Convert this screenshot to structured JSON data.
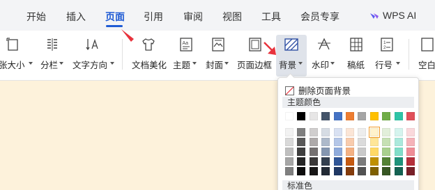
{
  "menu": {
    "tabs": [
      {
        "label": "开始"
      },
      {
        "label": "插入"
      },
      {
        "label": "页面"
      },
      {
        "label": "引用"
      },
      {
        "label": "审阅"
      },
      {
        "label": "视图"
      },
      {
        "label": "工具"
      },
      {
        "label": "会员专享"
      }
    ],
    "active_tab": "页面",
    "ai_label": "WPS AI"
  },
  "ribbon": {
    "size": "张大小",
    "columns": "分栏",
    "text_direction": "文字方向",
    "beautify": "文档美化",
    "theme": "主题",
    "cover": "封面",
    "page_border": "页面边框",
    "background": "背景",
    "watermark": "水印",
    "manuscript": "稿纸",
    "line_number": "行号",
    "blank_page": "空白"
  },
  "background_popup": {
    "remove_label": "删除页面背景",
    "theme_colors_label": "主题颜色",
    "standard_colors_label": "标准色",
    "base_row": [
      "#ffffff",
      "#000000",
      "#e7e6e6",
      "#44546a",
      "#4472c4",
      "#ed7d31",
      "#a5a5a5",
      "#ffc000",
      "#70ad47",
      "#2ec4a6",
      "#e0505a"
    ],
    "shade_rows": [
      [
        "#f2f2f2",
        "#7f7f7f",
        "#d0cece",
        "#d6dce4",
        "#d9e1f2",
        "#fbe5d6",
        "#ededed",
        "#fff2cc",
        "#e2efda",
        "#d5f4ee",
        "#fad9dc"
      ],
      [
        "#d9d9d9",
        "#595959",
        "#aeaaaa",
        "#adb9ca",
        "#b4c6e7",
        "#f8cbad",
        "#dbdbdb",
        "#ffe699",
        "#c6e0b4",
        "#abe9dc",
        "#f5b3b9"
      ],
      [
        "#bfbfbf",
        "#3f3f3f",
        "#757171",
        "#8496b0",
        "#8eaadb",
        "#f4b183",
        "#c9c9c9",
        "#ffd966",
        "#a9d08e",
        "#80dec9",
        "#ef8d96"
      ],
      [
        "#a6a6a6",
        "#262626",
        "#3a3838",
        "#333f4f",
        "#2f5597",
        "#c55a11",
        "#7b7b7b",
        "#bf9000",
        "#548235",
        "#1e937b",
        "#b5303b"
      ],
      [
        "#7f7f7f",
        "#0d0d0d",
        "#171616",
        "#222a35",
        "#1f3864",
        "#843c0c",
        "#525252",
        "#7f6000",
        "#375623",
        "#146252",
        "#781f27"
      ]
    ],
    "selected_swatch": "#fff2cc"
  }
}
